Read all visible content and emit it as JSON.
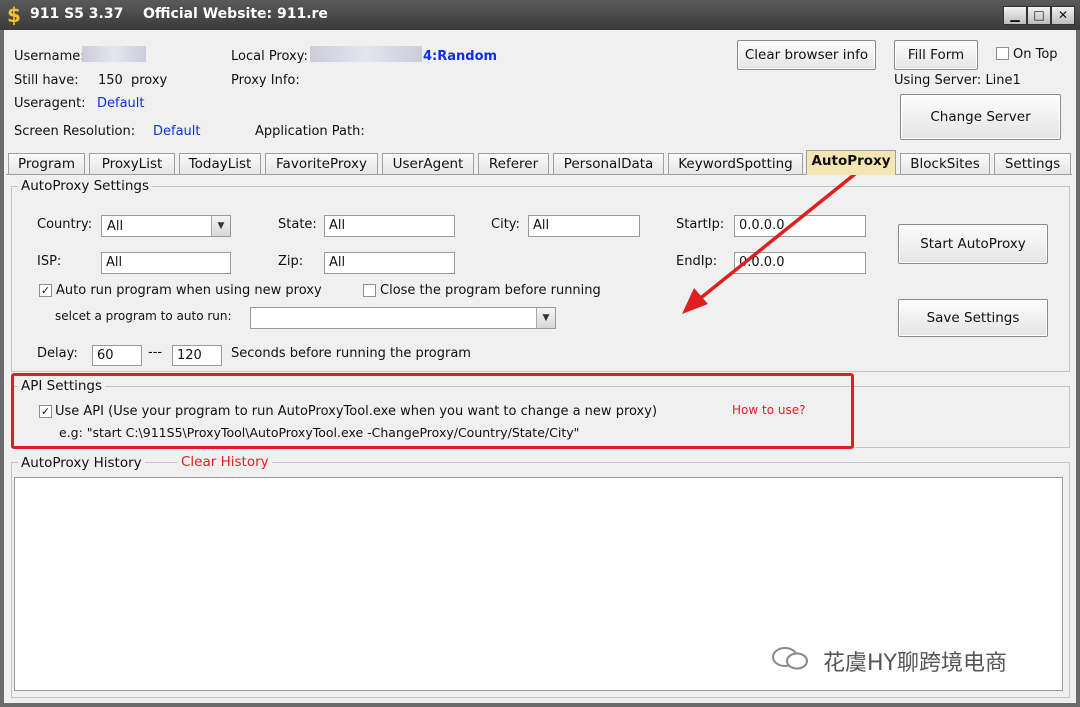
{
  "titlebar": {
    "app_name": "911 S5 3.37",
    "website": "Official Website:  911.re",
    "min": "▁",
    "max": "□",
    "close": "✕"
  },
  "header": {
    "username_label": "Username:",
    "local_proxy_label": "Local Proxy:",
    "local_proxy_suffix": "4:Random",
    "still_have_label": "Still have:",
    "proxy_count": "150",
    "proxy_unit": "proxy",
    "proxy_info_label": "Proxy Info:",
    "useragent_label": "Useragent:",
    "useragent_value": "Default",
    "screen_res_label": "Screen Resolution:",
    "screen_res_value": "Default",
    "app_path_label": "Application Path:",
    "clear_browser_btn": "Clear browser info",
    "fill_form_btn": "Fill Form",
    "on_top_label": "On Top",
    "using_server": "Using Server: Line1",
    "change_server_btn": "Change Server"
  },
  "tabs": [
    "Program",
    "ProxyList",
    "TodayList",
    "FavoriteProxy",
    "UserAgent",
    "Referer",
    "PersonalData",
    "KeywordSpotting",
    "AutoProxy",
    "BlockSites",
    "Settings"
  ],
  "active_tab": "AutoProxy",
  "autoproxy": {
    "group_title": "AutoProxy Settings",
    "country_label": "Country:",
    "country_value": "All",
    "state_label": "State:",
    "state_value": "All",
    "city_label": "City:",
    "city_value": "All",
    "startip_label": "StartIp:",
    "startip_value": "0.0.0.0",
    "isp_label": "ISP:",
    "isp_value": "All",
    "zip_label": "Zip:",
    "zip_value": "All",
    "endip_label": "EndIp:",
    "endip_value": "0.0.0.0",
    "auto_run_label": "Auto run program when using new proxy",
    "close_before_label": "Close the program before running",
    "select_program_label": "selcet a program to auto run:",
    "delay_label": "Delay:",
    "delay_from": "60",
    "delay_sep": "---",
    "delay_to": "120",
    "delay_suffix": "Seconds before running the program",
    "start_btn": "Start AutoProxy",
    "save_btn": "Save Settings"
  },
  "api": {
    "group_title": "API Settings",
    "use_api_label": "Use API (Use your program to run AutoProxyTool.exe when you want to change a new proxy)",
    "how_to_use": "How to use?",
    "example": "e.g: \"start C:\\911S5\\ProxyTool\\AutoProxyTool.exe -ChangeProxy/Country/State/City\""
  },
  "history": {
    "group_title": "AutoProxy History",
    "clear_link": "Clear History"
  },
  "watermark": "花虞HY聊跨境电商",
  "colors": {
    "highlight": "#e02020",
    "link": "#1030e0",
    "active_tab": "#f4e6b4"
  }
}
